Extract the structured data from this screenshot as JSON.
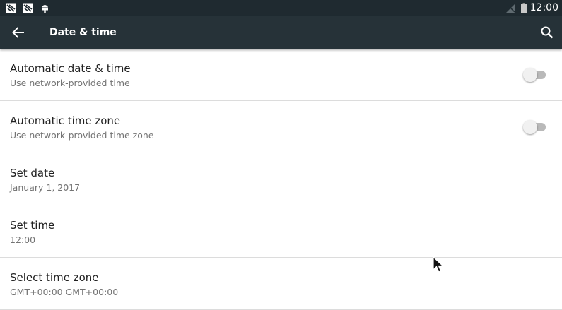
{
  "status_bar": {
    "time": "12:00",
    "left_icons": [
      "screenshot-notification-icon",
      "screenshot-notification-icon",
      "android-debug-icon"
    ],
    "right_icons": [
      "no-signal-icon",
      "battery-icon"
    ]
  },
  "toolbar": {
    "title": "Date & time",
    "back_icon": "arrow-back-icon",
    "search_icon": "search-icon"
  },
  "settings": {
    "items": [
      {
        "title": "Automatic date & time",
        "subtitle": "Use network-provided time",
        "toggle": false
      },
      {
        "title": "Automatic time zone",
        "subtitle": "Use network-provided time zone",
        "toggle": false
      },
      {
        "title": "Set date",
        "subtitle": "January 1, 2017"
      },
      {
        "title": "Set time",
        "subtitle": "12:00"
      },
      {
        "title": "Select time zone",
        "subtitle": "GMT+00:00 GMT+00:00"
      }
    ]
  },
  "colors": {
    "status_bar": "#1f2a30",
    "toolbar": "#263238",
    "switch_thumb_off": "#f1f1f1",
    "switch_track_off": "#b9b9b9"
  }
}
